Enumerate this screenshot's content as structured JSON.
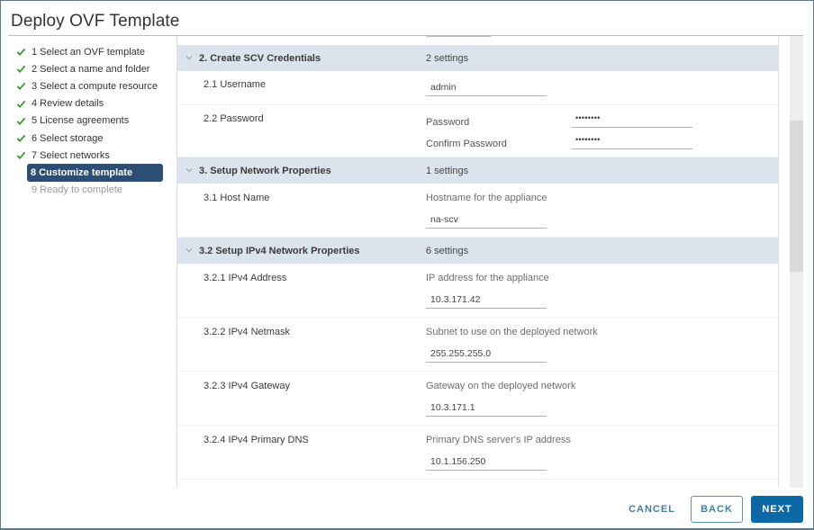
{
  "dialog": {
    "title": "Deploy OVF Template"
  },
  "steps": [
    {
      "label": "1 Select an OVF template",
      "state": "done"
    },
    {
      "label": "2 Select a name and folder",
      "state": "done"
    },
    {
      "label": "3 Select a compute resource",
      "state": "done"
    },
    {
      "label": "4 Review details",
      "state": "done"
    },
    {
      "label": "5 License agreements",
      "state": "done"
    },
    {
      "label": "6 Select storage",
      "state": "done"
    },
    {
      "label": "7 Select networks",
      "state": "done"
    },
    {
      "label": "8 Customize template",
      "state": "active"
    },
    {
      "label": "9 Ready to complete",
      "state": "pending"
    }
  ],
  "sections": {
    "credentials": {
      "title": "2. Create SCV Credentials",
      "count": "2 settings"
    },
    "network": {
      "title": "3. Setup Network Properties",
      "count": "1 settings"
    },
    "ipv4": {
      "title": "3.2 Setup IPv4 Network Properties",
      "count": "6 settings"
    }
  },
  "fields": {
    "username": {
      "label": "2.1 Username",
      "value": "admin"
    },
    "password": {
      "label": "2.2 Password",
      "password_label": "Password",
      "password_value": "••••••••",
      "confirm_label": "Confirm Password",
      "confirm_value": "••••••••"
    },
    "hostname": {
      "label": "3.1 Host Name",
      "description": "Hostname for the appliance",
      "value": "na-scv"
    },
    "ipv4_address": {
      "label": "3.2.1 IPv4 Address",
      "description": "IP address for the appliance",
      "value": "10.3.171.42"
    },
    "ipv4_netmask": {
      "label": "3.2.2 IPv4 Netmask",
      "description": "Subnet to use on the deployed network",
      "value": "255.255.255.0"
    },
    "ipv4_gateway": {
      "label": "3.2.3 IPv4 Gateway",
      "description": "Gateway on the deployed network",
      "value": "10.3.171.1"
    },
    "ipv4_dns": {
      "label": "3.2.4 IPv4 Primary DNS",
      "description": "Primary DNS server's IP address",
      "value": "10.1.156.250"
    }
  },
  "footer": {
    "cancel_label": "CANCEL",
    "back_label": "BACK",
    "next_label": "NEXT"
  },
  "colors": {
    "accent": "#0d69a6",
    "active_step": "#2d4e74",
    "section_header": "#dbe4ec",
    "check": "#3d9a2f"
  }
}
